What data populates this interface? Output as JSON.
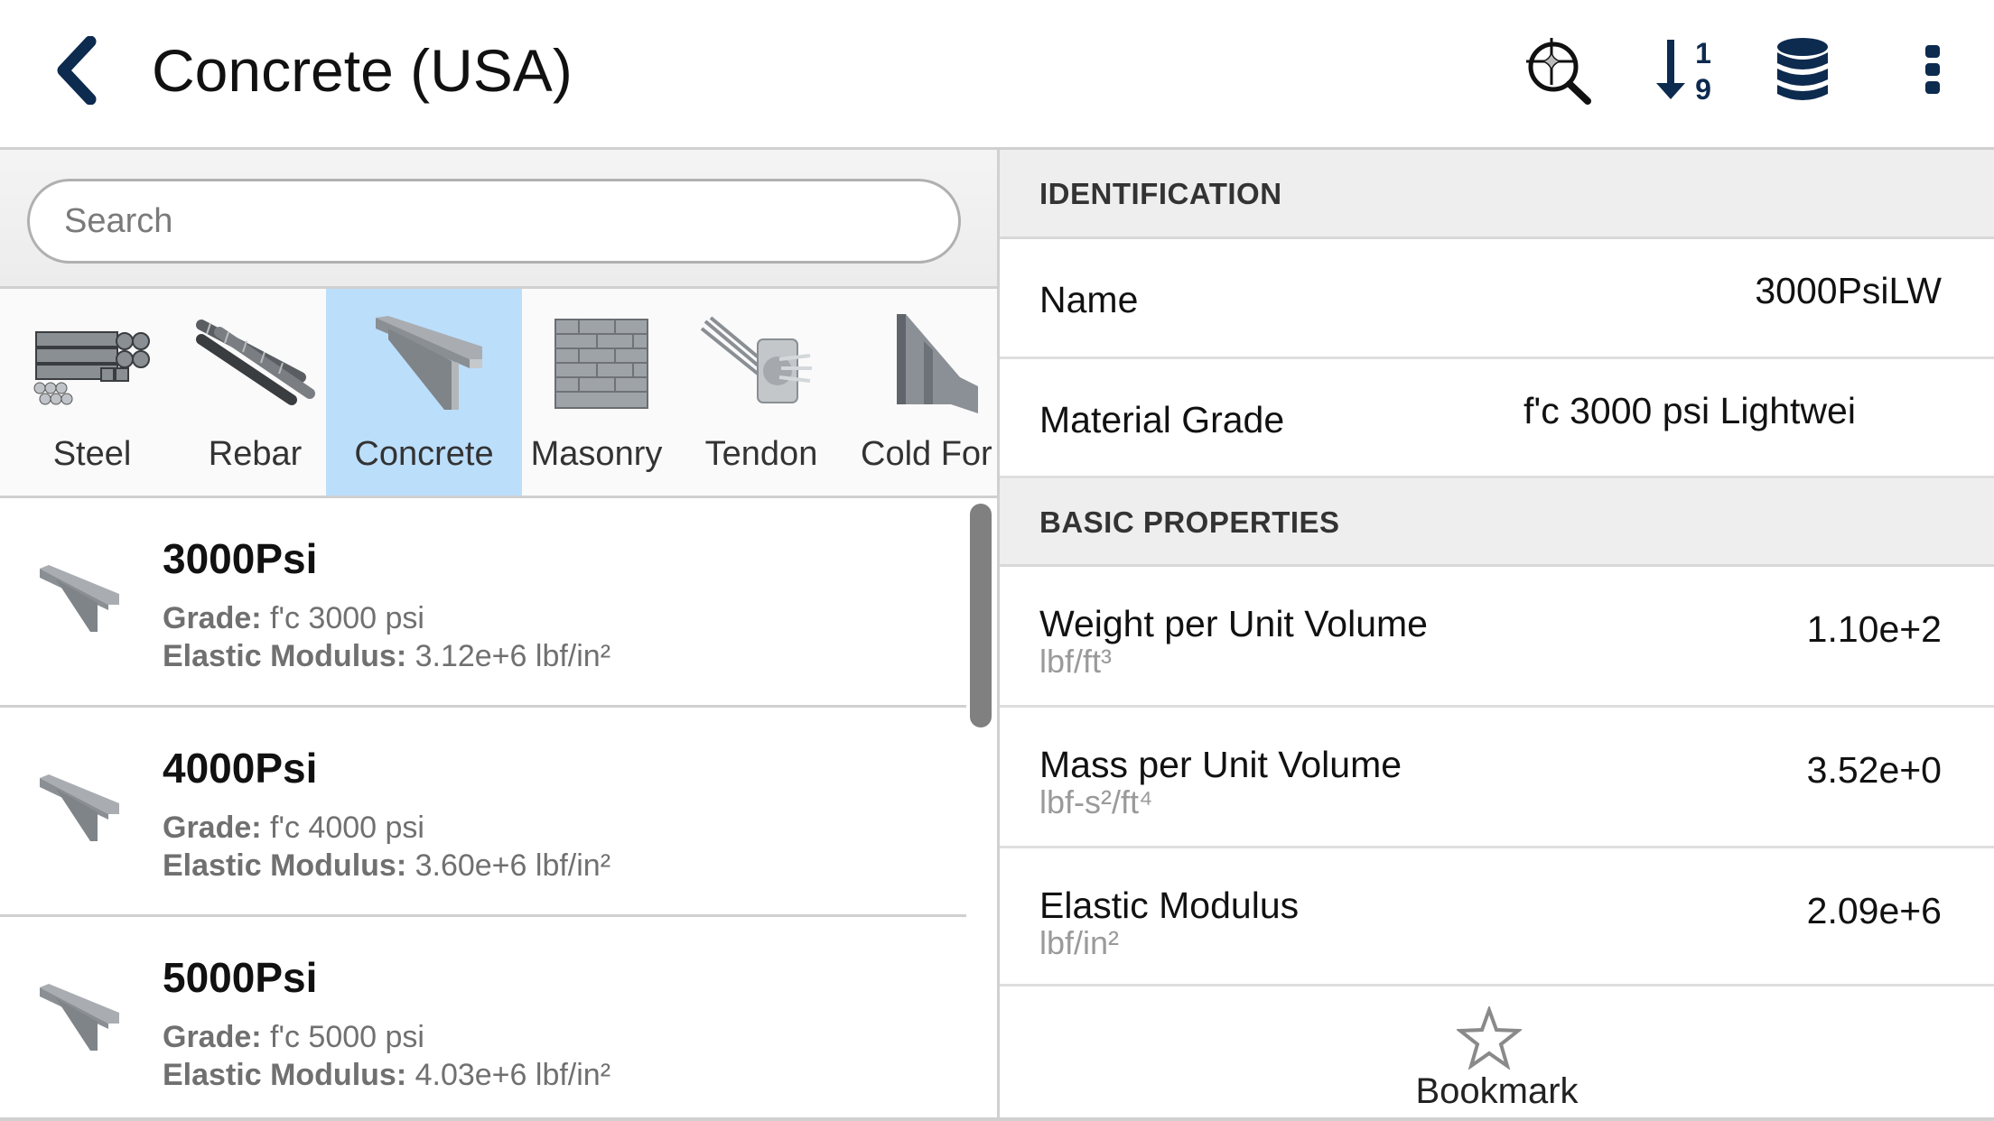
{
  "header": {
    "title": "Concrete (USA)",
    "icons": {
      "back": "chevron-left-icon",
      "find": "search-sparkle-icon",
      "sort": "sort-numeric-down-icon",
      "database": "database-icon",
      "more": "more-vertical-icon"
    }
  },
  "colors": {
    "brand_navy": "#0d2a4f",
    "selected_category": "#bbdefb",
    "section_header_bg": "#eeeeee"
  },
  "search": {
    "placeholder": "Search",
    "value": ""
  },
  "categories": [
    {
      "label": "Steel",
      "selected": false
    },
    {
      "label": "Rebar",
      "selected": false
    },
    {
      "label": "Concrete",
      "selected": true
    },
    {
      "label": "Masonry",
      "selected": false
    },
    {
      "label": "Tendon",
      "selected": false
    },
    {
      "label": "Cold For",
      "selected": false
    }
  ],
  "materials": [
    {
      "name": "3000Psi",
      "grade_label": "Grade:",
      "grade": "f'c 3000 psi",
      "modulus_label": "Elastic Modulus:",
      "modulus": "3.12e+6 lbf/in²"
    },
    {
      "name": "4000Psi",
      "grade_label": "Grade:",
      "grade": "f'c 4000 psi",
      "modulus_label": "Elastic Modulus:",
      "modulus": "3.60e+6 lbf/in²"
    },
    {
      "name": "5000Psi",
      "grade_label": "Grade:",
      "grade": "f'c 5000 psi",
      "modulus_label": "Elastic Modulus:",
      "modulus": "4.03e+6 lbf/in²"
    }
  ],
  "details": {
    "identification": {
      "title": "IDENTIFICATION",
      "rows": [
        {
          "label": "Name",
          "value": "3000PsiLW"
        },
        {
          "label": "Material Grade",
          "value": "f'c 3000 psi Lightwei"
        }
      ]
    },
    "basic_properties": {
      "title": "BASIC PROPERTIES",
      "rows": [
        {
          "label": "Weight per Unit Volume",
          "unit": "lbf/ft³",
          "value": "1.10e+2"
        },
        {
          "label": "Mass per Unit Volume",
          "unit": "lbf-s²/ft⁴",
          "value": "3.52e+0"
        },
        {
          "label": "Elastic Modulus",
          "unit": "lbf/in²",
          "value": "2.09e+6"
        }
      ]
    },
    "bookmark": {
      "label": "Bookmark",
      "icon": "star-outline-icon"
    }
  }
}
